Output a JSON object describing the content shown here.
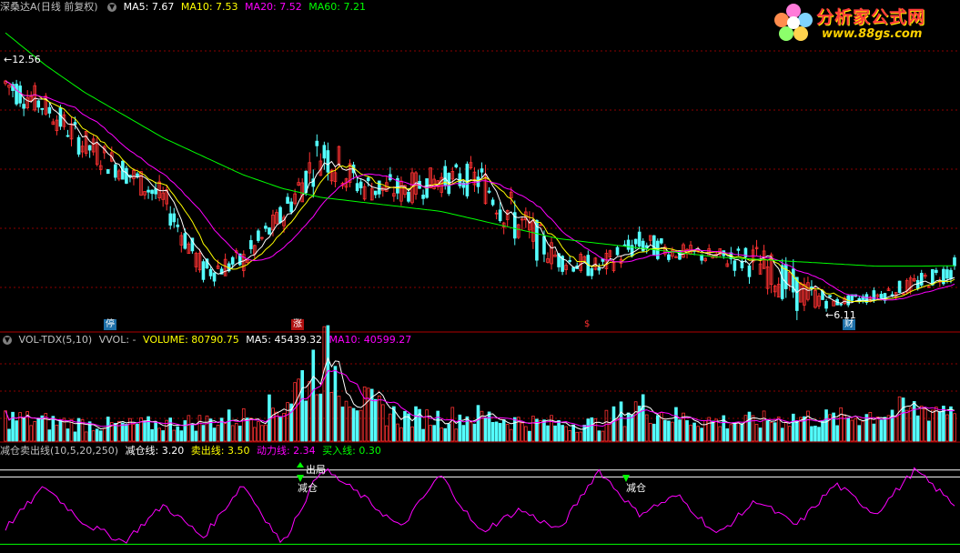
{
  "main_header": {
    "title": "深桑达A(日线 前复权)",
    "ma5": "MA5: 7.67",
    "ma10": "MA10: 7.53",
    "ma20": "MA20: 7.52",
    "ma60": "MA60: 7.21"
  },
  "main_annotations": {
    "high_label": "12.56",
    "low_label": "6.11",
    "event_ting": "停",
    "event_zhang": "涨",
    "event_dollar": "$",
    "event_cai": "财"
  },
  "volume_header": {
    "title": "VOL-TDX(5,10)",
    "vvol": "VVOL: -",
    "volume": "VOLUME: 80790.75",
    "ma5": "MA5: 45439.32",
    "ma10": "MA10: 40599.27"
  },
  "indicator_header": {
    "title": "减仓卖出线(10,5,20,250)",
    "jiancang": "减仓线: 3.20",
    "maichu": "卖出线: 3.50",
    "dongli": "动力线: 2.34",
    "mairu": "买入线: 0.30"
  },
  "indicator_annotations": {
    "chuju": "出局",
    "jiancang1": "减仓",
    "jiancang2": "减仓"
  },
  "logo": {
    "cn": "分析家公式网",
    "url": "www.88gs.com"
  },
  "colors": {
    "up": "#ff3232",
    "down": "#54ffff",
    "ma5": "#ffffff",
    "ma10": "#ffff00",
    "ma20": "#ff00ff",
    "ma60": "#00ff00",
    "grid": "#8b0000"
  },
  "chart_data": {
    "type": "candlestick",
    "title": "深桑达A(日线 前复权)",
    "y_high": 12.56,
    "y_low": 6.11,
    "price_envelope_high": [
      11.6,
      11.0,
      10.2,
      9.6,
      9.0,
      7.4,
      7.6,
      8.6,
      10.3,
      9.3,
      9.2,
      9.4,
      9.5,
      8.7,
      7.6,
      7.4,
      8.0,
      7.7,
      7.6,
      7.7,
      7.1,
      6.5,
      6.7,
      7.0,
      7.4
    ],
    "price_envelope_low": [
      10.8,
      10.4,
      9.5,
      9.0,
      8.3,
      6.8,
      7.0,
      8.0,
      9.2,
      8.6,
      8.5,
      8.8,
      8.7,
      7.5,
      7.1,
      6.9,
      7.4,
      7.3,
      7.2,
      6.9,
      6.2,
      6.3,
      6.4,
      6.6,
      6.9
    ],
    "ma60": [
      12.3,
      11.6,
      11.0,
      10.5,
      10.0,
      9.6,
      9.2,
      8.9,
      8.7,
      8.6,
      8.5,
      8.4,
      8.2,
      8.0,
      7.8,
      7.7,
      7.6,
      7.5,
      7.4,
      7.35,
      7.3,
      7.25,
      7.2,
      7.2,
      7.21
    ],
    "volume_envelope": [
      30000,
      25000,
      22000,
      20000,
      22000,
      25000,
      30000,
      45000,
      110000,
      50000,
      30000,
      30000,
      32000,
      25000,
      22000,
      22000,
      45000,
      30000,
      25000,
      25000,
      30000,
      28000,
      35000,
      40000,
      45000
    ],
    "indicator_values": [
      1.0,
      2.8,
      1.2,
      0.4,
      2.0,
      0.6,
      2.9,
      0.3,
      3.6,
      2.4,
      1.0,
      3.3,
      0.8,
      1.8,
      0.9,
      3.5,
      1.6,
      2.4,
      0.7,
      2.2,
      1.1,
      2.9,
      1.6,
      3.5,
      2.0
    ],
    "indicator_lines": {
      "jiancang": 3.2,
      "maichu": 3.5,
      "mairu": 0.3
    }
  }
}
